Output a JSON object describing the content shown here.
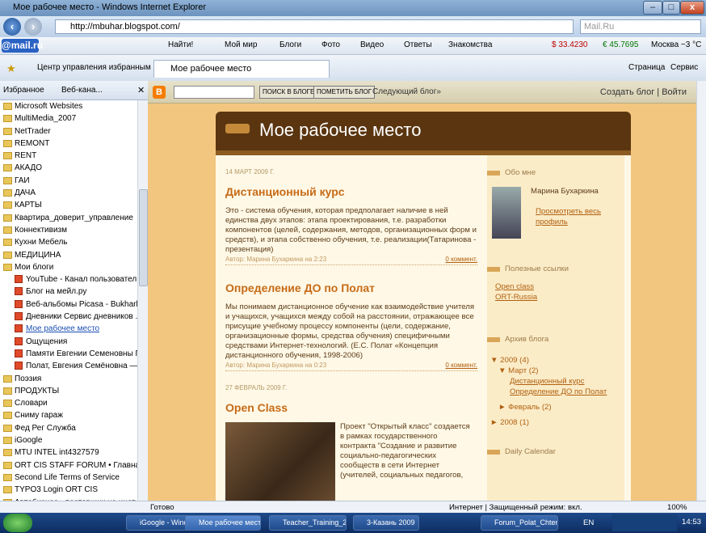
{
  "window": {
    "title": "Мое рабочее место - Windows Internet Explorer"
  },
  "address": {
    "url": "http://mbuhar.blogspot.com/",
    "search_placeholder": "Mail.Ru"
  },
  "mailbar": {
    "logo": "@mail.ru",
    "items": [
      "Найти!",
      "Мой мир",
      "Блоги",
      "Фото",
      "Видео",
      "Ответы",
      "Знакомства"
    ],
    "usd": "$ 33.4230",
    "eur": "€ 45.7695",
    "weather": "Москва −3 °C"
  },
  "favbar": {
    "center_label": "Центр управления избранным",
    "tab_label": "Мое рабочее место",
    "page_label": "Страница",
    "service_label": "Сервис"
  },
  "favpane": {
    "tab_favorites": "Избранное",
    "tab_feeds": "Веб-кана...",
    "items": [
      {
        "label": "Microsoft Websites",
        "sub": false
      },
      {
        "label": "MultiMedia_2007",
        "sub": false
      },
      {
        "label": "NetTrader",
        "sub": false
      },
      {
        "label": "REMONT",
        "sub": false
      },
      {
        "label": "RENT",
        "sub": false
      },
      {
        "label": "АКАДО",
        "sub": false
      },
      {
        "label": "ГАИ",
        "sub": false
      },
      {
        "label": "ДАЧА",
        "sub": false
      },
      {
        "label": "КАРТЫ",
        "sub": false
      },
      {
        "label": "Квартира_доверит_управление",
        "sub": false
      },
      {
        "label": "Коннективизм",
        "sub": false
      },
      {
        "label": "Кухни Мебель",
        "sub": false
      },
      {
        "label": "МЕДИЦИНА",
        "sub": false
      },
      {
        "label": "Мои блоги",
        "sub": false
      },
      {
        "label": "YouTube - Канал пользовател...",
        "sub": true
      },
      {
        "label": "Блог на мейл.ру",
        "sub": true
      },
      {
        "label": "Веб-альбомы Picasa - Bukharki...",
        "sub": true
      },
      {
        "label": "Дневники Сервис дневников ...",
        "sub": true
      },
      {
        "label": "Мое рабочее место",
        "sub": true
      },
      {
        "label": "Ощущения",
        "sub": true
      },
      {
        "label": "Памяти Евгении Семеновны П...",
        "sub": true
      },
      {
        "label": "Полат, Евгения Семёновна — ...",
        "sub": true
      },
      {
        "label": "Поэзия",
        "sub": false
      },
      {
        "label": "ПРОДУКТЫ",
        "sub": false
      },
      {
        "label": "Словари",
        "sub": false
      },
      {
        "label": "Сниму гараж",
        "sub": false
      },
      {
        "label": "Фед Рег Служба",
        "sub": false
      },
      {
        "label": "iGoogle",
        "sub": false
      },
      {
        "label": "MTU INTEL int4327579",
        "sub": false
      },
      {
        "label": "ORT CIS STAFF FORUM • Главная с...",
        "sub": false
      },
      {
        "label": "Second Life  Terms of Service",
        "sub": false
      },
      {
        "label": "TYPO3 Login ORT CIS",
        "sub": false
      },
      {
        "label": "Автобизнес - поставщик на инет...",
        "sub": false
      }
    ]
  },
  "blogger_nav": {
    "search_btn": "ПОИСК В БЛОГЕ",
    "flag_btn": "ПОМЕТИТЬ БЛОГ",
    "next_blog": "Следующий блог»",
    "create": "Создать блог",
    "login": "Войти"
  },
  "blog": {
    "title": "Мое рабочее место",
    "posts": [
      {
        "date": "14 МАРТ 2009 Г.",
        "title": "Дистанционный курс",
        "body": "Это - система обучения, которая предполагает наличие в ней единства двух этапов: этапа проектирования, т.е. разработки компонентов (целей, содержания, методов, организационных форм и средств), и этапа собственно обучения, т.е. реализации(Татаринова - презентация)",
        "author": "Автор: Марина Бухаркина  на 2:23",
        "comments": "0 коммент."
      },
      {
        "date": "",
        "title": "Определение ДО по Полат",
        "body": "Мы понимаем дистанционное обучение как взаимодействие учителя и учащихся, учащихся между собой на расстоянии, отражающее все присущие учебному процессу компоненты (цели, содержание, организационные формы, средства обучения) специфичными средствами Интернет-технологий. (Е.С. Полат «Концепция дистанционного обучения, 1998-2006)",
        "author": "Автор: Марина Бухаркина  на 0:23",
        "comments": "0 коммент."
      },
      {
        "date": "27 ФЕВРАЛЬ 2009 Г.",
        "title": "Open Class",
        "body": "Проект \"Открытый класс\" создается в рамках государственного контракта \"Создание и развитие социально-педагогических сообществ в сети Интернет (учителей, социальных педагогов,",
        "author": "",
        "comments": ""
      }
    ]
  },
  "sidebar": {
    "about_head": "Обо мне",
    "author_name": "Марина Бухаркина",
    "profile_link": "Просмотреть весь профиль",
    "links_head": "Полезные ссылки",
    "links": [
      "Open class",
      "ORT-Russia"
    ],
    "archive_head": "Архив блога",
    "archive": [
      "▼ 2009 (4)",
      "▼ Март (2)",
      "Дистанционный курс",
      "Определение ДО по Полат",
      "► Февраль (2)",
      "► 2008 (1)"
    ],
    "calendar_head": "Daily Calendar"
  },
  "status": {
    "left": "Готово",
    "zone": "Интернет | Защищенный режим: вкл.",
    "zoom": "100%"
  },
  "taskbar": {
    "items": [
      "iGoogle - Windows I...",
      "Мое рабочее мест...",
      "Teacher_Training_2...",
      "3-Казань 2009",
      "Forum_Polat_Chten ..."
    ],
    "lang": "EN",
    "clock": "14:53"
  }
}
